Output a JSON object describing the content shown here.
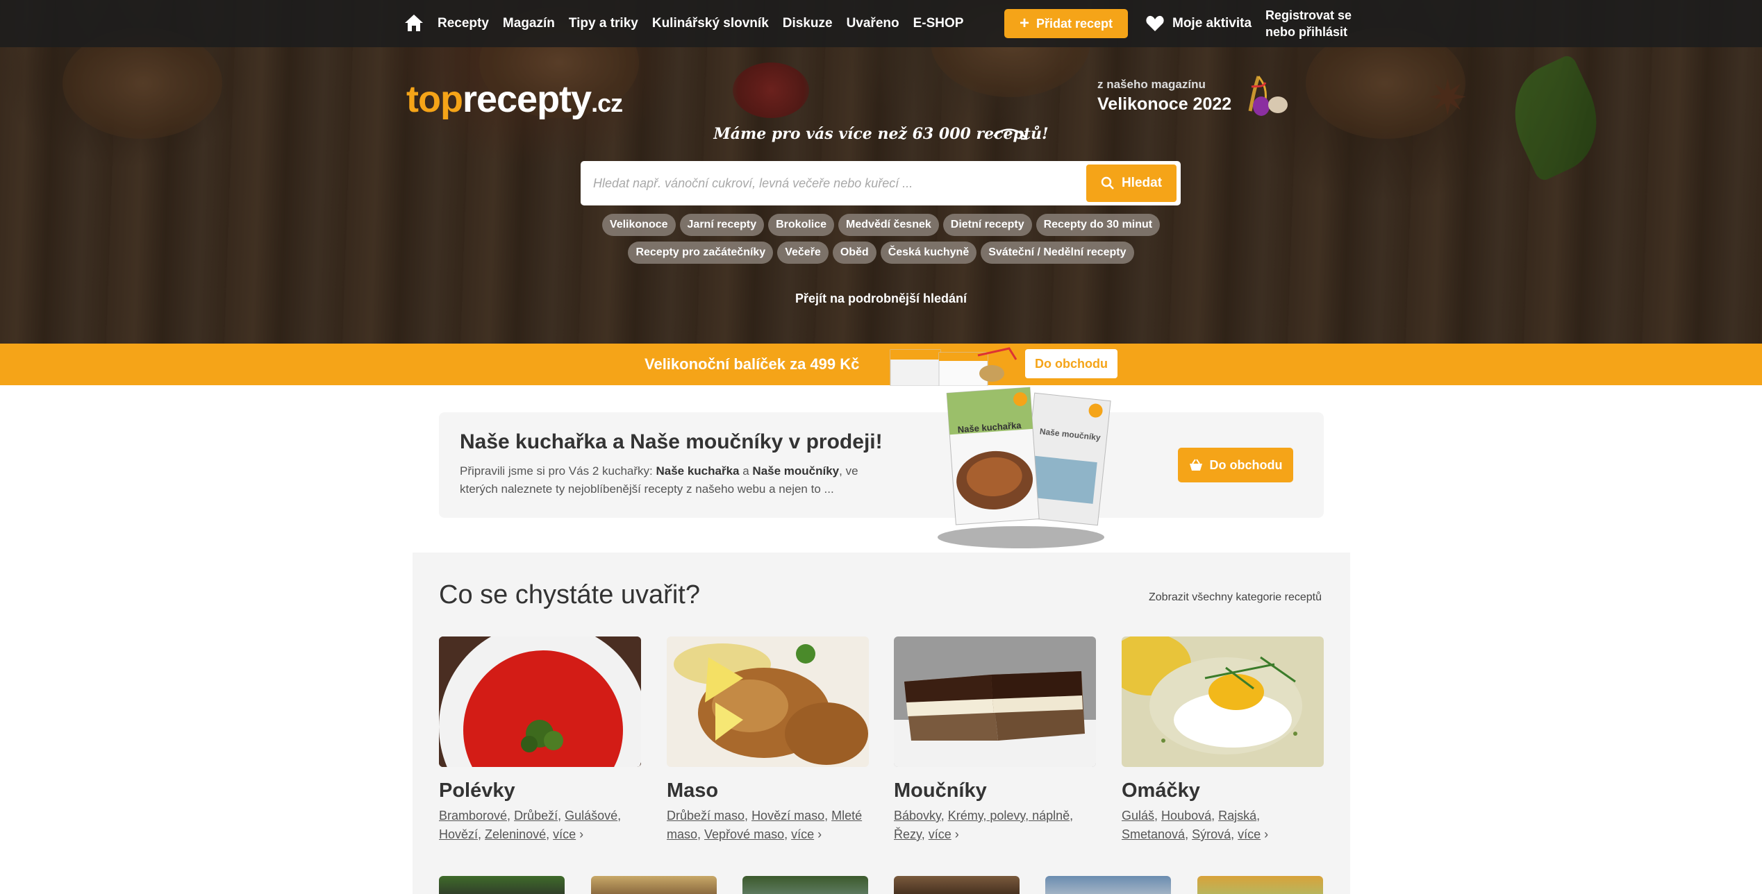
{
  "nav": {
    "home_icon": "home-icon",
    "items": [
      "Recepty",
      "Magazín",
      "Tipy a triky",
      "Kulinářský slovník",
      "Diskuze",
      "Uvařeno",
      "E-SHOP"
    ],
    "add_recipe": "Přidat recept",
    "activity": "Moje aktivita",
    "login_line1": "Registrovat se",
    "login_line2": "nebo přihlásit"
  },
  "logo": {
    "part1": "top",
    "part2": "recepty",
    "part3": ".cz"
  },
  "magazine": {
    "small": "z našeho magazínu",
    "title": "Velikonoce 2022"
  },
  "tagline": "Máme pro vás více než 63 000 receptů!",
  "search": {
    "placeholder": "Hledat např. vánoční cukroví, levná večeře nebo kuřecí ...",
    "button": "Hledat"
  },
  "chips_row1": [
    "Velikonoce",
    "Jarní recepty",
    "Brokolice",
    "Medvědí česnek",
    "Dietní recepty",
    "Recepty do 30 minut"
  ],
  "chips_row2": [
    "Recepty pro začátečníky",
    "Večeře",
    "Oběd",
    "Česká kuchyně",
    "Sváteční / Nedělní recepty"
  ],
  "advanced_search": "Přejít na podrobnější hledání",
  "banner": {
    "text": "Velikonoční balíček za 499 Kč",
    "button": "Do obchodu"
  },
  "promo": {
    "title": "Naše kuchařka a Naše moučníky v prodeji!",
    "text_before": "Připravili jsme si pro Vás 2 kuchařky: ",
    "book1": "Naše kuchařka",
    "and": " a ",
    "book2": "Naše moučníky",
    "text_after": ", ve kterých naleznete ty nejoblíbenější recepty z našeho webu a nejen to ...",
    "book1_cover": "Naše kuchařka",
    "book2_cover": "Naše moučníky",
    "button": "Do obchodu"
  },
  "categories": {
    "heading": "Co se chystáte uvařit?",
    "show_all": "Zobrazit všechny kategorie receptů",
    "more": "více",
    "cards": [
      {
        "title": "Polévky",
        "links": [
          "Bramborové",
          "Drůbeží",
          "Gulášové",
          "Hovězí",
          "Zeleninové"
        ]
      },
      {
        "title": "Maso",
        "links": [
          "Drůbeží maso",
          "Hovězí maso",
          "Mleté maso",
          "Vepřové maso"
        ]
      },
      {
        "title": "Moučníky",
        "links": [
          "Bábovky",
          "Krémy, polevy, náplně",
          "Řezy"
        ]
      },
      {
        "title": "Omáčky",
        "links": [
          "Guláš",
          "Houbová",
          "Rajská",
          "Smetanová",
          "Sýrová"
        ]
      }
    ]
  },
  "colors": {
    "accent": "#f5a418",
    "nav_bg": "#1c1c1c",
    "text": "#333333"
  }
}
